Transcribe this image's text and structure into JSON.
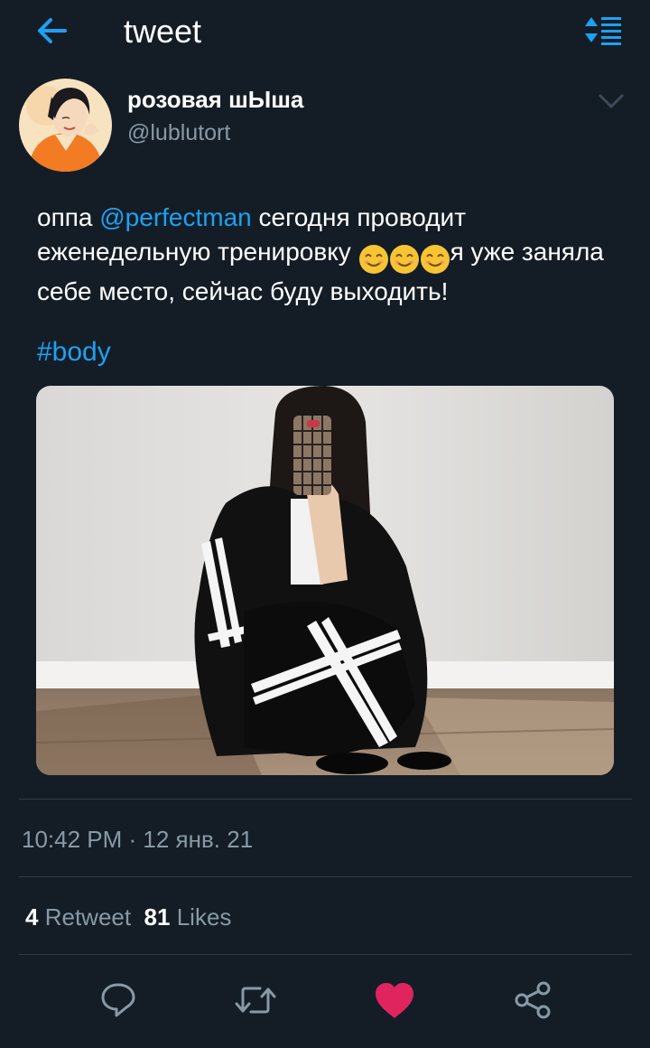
{
  "header": {
    "title": "tweet",
    "back_icon": "arrow-left-icon",
    "sort_icon": "sort-icon",
    "accent": "#1da1f2"
  },
  "author": {
    "name": "розовая шЫша",
    "handle": "@lublutort"
  },
  "tweet": {
    "text_before": "оппа ",
    "mention": "@perfectman",
    "text_line_rest": " сегодня проводит еженедельную тренировку ",
    "emoji": "😊😊😊",
    "text_after": "я уже заняла себе место, сейчас буду выходить!",
    "hashtag": "#body",
    "timestamp": "10:42 PM · 12 янв. 21"
  },
  "stats": {
    "retweets": "4",
    "retweet_label": "Retweet",
    "likes": "81",
    "likes_label": "Likes"
  },
  "actions": [
    {
      "icon": "reply-icon"
    },
    {
      "icon": "retweet-icon"
    },
    {
      "icon": "heart-icon",
      "active_color": "#e0245e"
    },
    {
      "icon": "share-icon"
    }
  ],
  "colors": {
    "background": "#141d26",
    "muted": "#8899a6",
    "link": "#1da1f2",
    "like": "#e0245e"
  }
}
